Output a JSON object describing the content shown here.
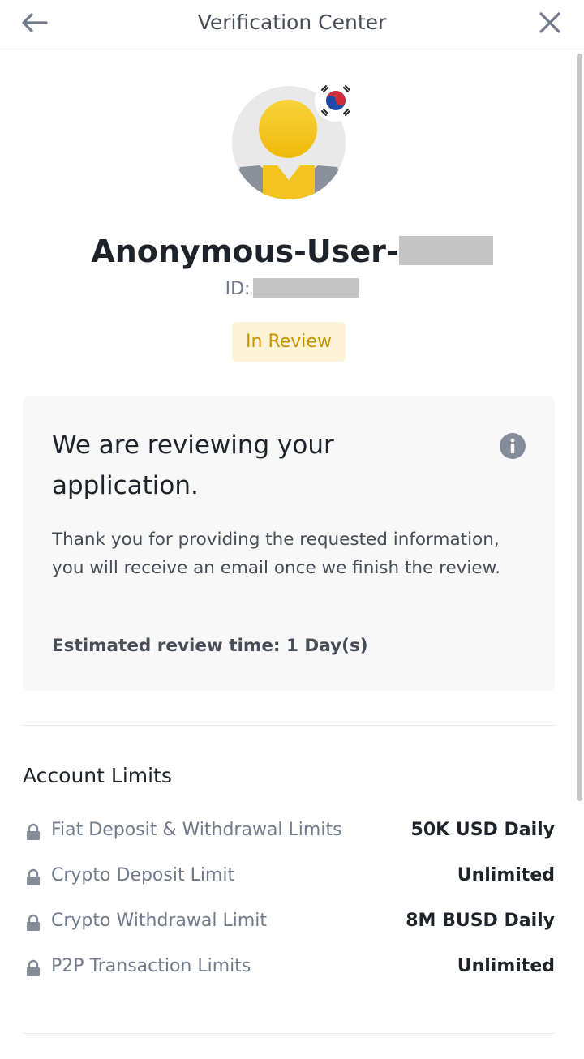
{
  "header": {
    "title": "Verification Center",
    "back_icon": "arrow-left-icon",
    "close_icon": "close-icon"
  },
  "profile": {
    "avatar_icon": "avatar-icon",
    "flag_icon": "south-korea-flag-icon",
    "username_prefix": "Anonymous-User-",
    "id_label": "ID:",
    "status": "In Review"
  },
  "review_card": {
    "title": "We are reviewing your application.",
    "info_icon": "info-icon",
    "body": "Thank you for providing the requested information, you will receive an email once we finish the review.",
    "estimate": "Estimated review time: 1 Day(s)"
  },
  "account_limits": {
    "title": "Account Limits",
    "items": [
      {
        "label": "Fiat Deposit & Withdrawal Limits",
        "value": "50K USD Daily"
      },
      {
        "label": "Crypto Deposit Limit",
        "value": "Unlimited"
      },
      {
        "label": "Crypto Withdrawal Limit",
        "value": "8M BUSD Daily"
      },
      {
        "label": "P2P Transaction Limits",
        "value": "Unlimited"
      }
    ]
  },
  "colors": {
    "accent_yellow": "#f0b90b",
    "status_text": "#c99400",
    "status_bg": "#fdf3d6",
    "primary_text": "#1e2329",
    "secondary_text": "#707a8a"
  }
}
